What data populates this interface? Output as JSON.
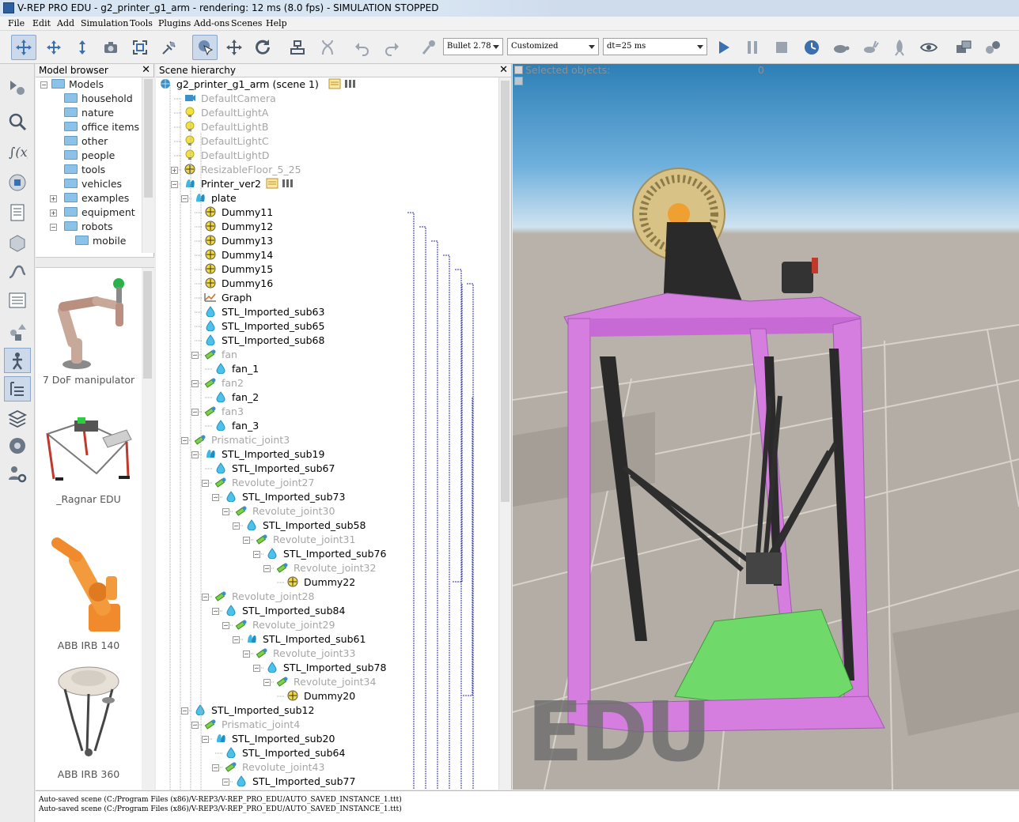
{
  "window": {
    "title": "V-REP PRO EDU - g2_printer_g1_arm - rendering: 12 ms (8.0 fps) - SIMULATION STOPPED"
  },
  "menu": [
    "File",
    "Edit",
    "Add",
    "Simulation",
    "Tools",
    "Plugins",
    "Add-ons",
    "Scenes",
    "Help"
  ],
  "toolbar": {
    "engine": "Bullet 2.78",
    "settings": "Customized",
    "dt": "dt=25 ms",
    "icons": [
      "move-camera-icon",
      "rotate-camera-icon",
      "shift-camera-icon",
      "camera-angle-icon",
      "fit-to-view-icon",
      "manipulate-icon",
      "select-icon",
      "translate-object-icon",
      "rotate-object-icon",
      "assemble-icon",
      "transfer-dna-icon",
      "undo-icon",
      "redo-icon",
      "dynamics-engine-icon",
      "play-icon",
      "pause-icon",
      "stop-icon",
      "realtime-icon",
      "slow-down-icon",
      "speed-up-icon",
      "thread-rendering-icon",
      "visualization-icon",
      "page-selector-icon",
      "scene-selector-icon"
    ]
  },
  "left_toolbar": [
    "object-properties-icon",
    "calculation-modules-icon",
    "collections-icon",
    "scripts-icon",
    "shape-edit-icon",
    "path-edit-icon",
    "selection-icon",
    "model-browser-icon",
    "scene-hierarchy-icon",
    "layers-icon",
    "video-recorder-icon",
    "user-settings-icon"
  ],
  "model_browser": {
    "title": "Model browser",
    "root": "Models",
    "folders": [
      "household",
      "nature",
      "office items",
      "other",
      "people",
      "tools",
      "vehicles",
      "examples",
      "equipment",
      "robots",
      "mobile"
    ],
    "thumbnails": [
      "7 DoF manipulator",
      "_Ragnar EDU",
      "ABB IRB 140",
      "ABB IRB 360"
    ]
  },
  "scene_hierarchy": {
    "title": "Scene hierarchy",
    "scene": "g2_printer_g1_arm (scene 1)",
    "nodes": [
      {
        "label": "DefaultCamera",
        "depth": 1,
        "dim": true,
        "icon": "camera"
      },
      {
        "label": "DefaultLightA",
        "depth": 1,
        "dim": true,
        "icon": "light"
      },
      {
        "label": "DefaultLightB",
        "depth": 1,
        "dim": true,
        "icon": "light"
      },
      {
        "label": "DefaultLightC",
        "depth": 1,
        "dim": true,
        "icon": "light"
      },
      {
        "label": "DefaultLightD",
        "depth": 1,
        "dim": true,
        "icon": "light"
      },
      {
        "label": "ResizableFloor_5_25",
        "depth": 1,
        "dim": true,
        "icon": "dummy",
        "exp": "plus"
      },
      {
        "label": "Printer_ver2",
        "depth": 1,
        "dim": false,
        "icon": "multishape",
        "exp": "minus"
      },
      {
        "label": "plate",
        "depth": 2,
        "dim": false,
        "icon": "multishape",
        "exp": "minus"
      },
      {
        "label": "Dummy11",
        "depth": 3,
        "dim": false,
        "icon": "dummy"
      },
      {
        "label": "Dummy12",
        "depth": 3,
        "dim": false,
        "icon": "dummy"
      },
      {
        "label": "Dummy13",
        "depth": 3,
        "dim": false,
        "icon": "dummy"
      },
      {
        "label": "Dummy14",
        "depth": 3,
        "dim": false,
        "icon": "dummy"
      },
      {
        "label": "Dummy15",
        "depth": 3,
        "dim": false,
        "icon": "dummy"
      },
      {
        "label": "Dummy16",
        "depth": 3,
        "dim": false,
        "icon": "dummy"
      },
      {
        "label": "Graph",
        "depth": 3,
        "dim": false,
        "icon": "graph"
      },
      {
        "label": "STL_Imported_sub63",
        "depth": 3,
        "dim": false,
        "icon": "shape"
      },
      {
        "label": "STL_Imported_sub65",
        "depth": 3,
        "dim": false,
        "icon": "shape"
      },
      {
        "label": "STL_Imported_sub68",
        "depth": 3,
        "dim": false,
        "icon": "shape"
      },
      {
        "label": "fan",
        "depth": 3,
        "dim": true,
        "icon": "joint",
        "exp": "minus"
      },
      {
        "label": "fan_1",
        "depth": 4,
        "dim": false,
        "icon": "shape"
      },
      {
        "label": "fan2",
        "depth": 3,
        "dim": true,
        "icon": "joint",
        "exp": "minus"
      },
      {
        "label": "fan_2",
        "depth": 4,
        "dim": false,
        "icon": "shape"
      },
      {
        "label": "fan3",
        "depth": 3,
        "dim": true,
        "icon": "joint",
        "exp": "minus"
      },
      {
        "label": "fan_3",
        "depth": 4,
        "dim": false,
        "icon": "shape"
      },
      {
        "label": "Prismatic_joint3",
        "depth": 2,
        "dim": true,
        "icon": "joint",
        "exp": "minus"
      },
      {
        "label": "STL_Imported_sub19",
        "depth": 3,
        "dim": false,
        "icon": "multishape",
        "exp": "minus"
      },
      {
        "label": "STL_Imported_sub67",
        "depth": 4,
        "dim": false,
        "icon": "shape"
      },
      {
        "label": "Revolute_joint27",
        "depth": 4,
        "dim": true,
        "icon": "joint",
        "exp": "minus"
      },
      {
        "label": "STL_Imported_sub73",
        "depth": 5,
        "dim": false,
        "icon": "shape",
        "exp": "minus"
      },
      {
        "label": "Revolute_joint30",
        "depth": 6,
        "dim": true,
        "icon": "joint",
        "exp": "minus"
      },
      {
        "label": "STL_Imported_sub58",
        "depth": 7,
        "dim": false,
        "icon": "shape",
        "exp": "minus"
      },
      {
        "label": "Revolute_joint31",
        "depth": 8,
        "dim": true,
        "icon": "joint",
        "exp": "minus"
      },
      {
        "label": "STL_Imported_sub76",
        "depth": 9,
        "dim": false,
        "icon": "shape",
        "exp": "minus"
      },
      {
        "label": "Revolute_joint32",
        "depth": 10,
        "dim": true,
        "icon": "joint",
        "exp": "minus"
      },
      {
        "label": "Dummy22",
        "depth": 11,
        "dim": false,
        "icon": "dummy"
      },
      {
        "label": "Revolute_joint28",
        "depth": 4,
        "dim": true,
        "icon": "joint",
        "exp": "minus"
      },
      {
        "label": "STL_Imported_sub84",
        "depth": 5,
        "dim": false,
        "icon": "shape",
        "exp": "minus"
      },
      {
        "label": "Revolute_joint29",
        "depth": 6,
        "dim": true,
        "icon": "joint",
        "exp": "minus"
      },
      {
        "label": "STL_Imported_sub61",
        "depth": 7,
        "dim": false,
        "icon": "multishape",
        "exp": "minus"
      },
      {
        "label": "Revolute_joint33",
        "depth": 8,
        "dim": true,
        "icon": "joint",
        "exp": "minus"
      },
      {
        "label": "STL_Imported_sub78",
        "depth": 9,
        "dim": false,
        "icon": "shape",
        "exp": "minus"
      },
      {
        "label": "Revolute_joint34",
        "depth": 10,
        "dim": true,
        "icon": "joint",
        "exp": "minus"
      },
      {
        "label": "Dummy20",
        "depth": 11,
        "dim": false,
        "icon": "dummy"
      },
      {
        "label": "STL_Imported_sub12",
        "depth": 2,
        "dim": false,
        "icon": "shape",
        "exp": "minus"
      },
      {
        "label": "Prismatic_joint4",
        "depth": 3,
        "dim": true,
        "icon": "joint",
        "exp": "minus"
      },
      {
        "label": "STL_Imported_sub20",
        "depth": 4,
        "dim": false,
        "icon": "multishape",
        "exp": "minus"
      },
      {
        "label": "STL_Imported_sub64",
        "depth": 5,
        "dim": false,
        "icon": "shape"
      },
      {
        "label": "Revolute_joint43",
        "depth": 5,
        "dim": true,
        "icon": "joint",
        "exp": "minus"
      },
      {
        "label": "STL_Imported_sub77",
        "depth": 6,
        "dim": false,
        "icon": "shape",
        "exp": "minus"
      }
    ]
  },
  "viewport": {
    "selected_label": "Selected objects:",
    "selected_count": "0",
    "watermark": "EDU"
  },
  "status": [
    "Auto-saved scene (C:/Program Files (x86)/V-REP3/V-REP_PRO_EDU/AUTO_SAVED_INSTANCE_1.ttt)",
    "Auto-saved scene (C:/Program Files (x86)/V-REP3/V-REP_PRO_EDU/AUTO_SAVED_INSTANCE_1.ttt)"
  ],
  "colors": {
    "frame": "#d67ee0",
    "bed": "#6fd96a",
    "spool": "#d9c48a",
    "floor": "#b9b2aa"
  }
}
